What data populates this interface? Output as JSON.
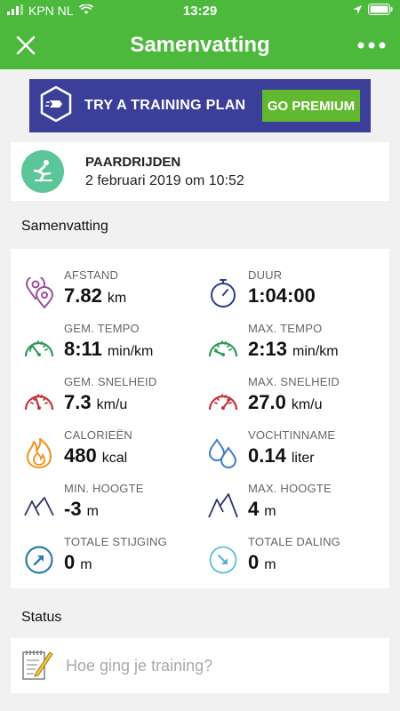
{
  "status_bar": {
    "carrier": "KPN NL",
    "time": "13:29"
  },
  "nav": {
    "title": "Samenvatting"
  },
  "banner": {
    "text": "TRY A TRAINING PLAN",
    "button": "GO PREMIUM"
  },
  "activity": {
    "type": "PAARDRIJDEN",
    "date": "2 februari 2019 om 10:52"
  },
  "sections": {
    "summary": "Samenvatting",
    "status": "Status"
  },
  "stats": [
    {
      "label": "AFSTAND",
      "value": "7.82",
      "unit": "km",
      "icon": "location-pins-icon"
    },
    {
      "label": "DUUR",
      "value": "1:04:00",
      "unit": "",
      "icon": "stopwatch-icon"
    },
    {
      "label": "GEM. TEMPO",
      "value": "8:11",
      "unit": "min/km",
      "icon": "speedometer-icon"
    },
    {
      "label": "MAX. TEMPO",
      "value": "2:13",
      "unit": "min/km",
      "icon": "speedometer-icon"
    },
    {
      "label": "GEM. SNELHEID",
      "value": "7.3",
      "unit": "km/u",
      "icon": "speedometer-icon"
    },
    {
      "label": "MAX. SNELHEID",
      "value": "27.0",
      "unit": "km/u",
      "icon": "speedometer-icon"
    },
    {
      "label": "CALORIEËN",
      "value": "480",
      "unit": "kcal",
      "icon": "flame-icon"
    },
    {
      "label": "VOCHTINNAME",
      "value": "0.14",
      "unit": "liter",
      "icon": "water-drops-icon"
    },
    {
      "label": "MIN. HOOGTE",
      "value": "-3",
      "unit": "m",
      "icon": "mountain-icon"
    },
    {
      "label": "MAX. HOOGTE",
      "value": "4",
      "unit": "m",
      "icon": "mountain-icon"
    },
    {
      "label": "TOTALE STIJGING",
      "value": "0",
      "unit": "m",
      "icon": "ascent-arrow-icon"
    },
    {
      "label": "TOTALE DALING",
      "value": "0",
      "unit": "m",
      "icon": "descent-arrow-icon"
    }
  ],
  "status_input": {
    "placeholder": "Hoe ging je training?"
  },
  "colors": {
    "header_green": "#4cb93d",
    "banner_blue": "#3b3f9a",
    "premium_green": "#62b82f",
    "speed_green": "#2f9a57",
    "speed_red": "#c8323a",
    "location_purple": "#9b4e9a",
    "stopwatch_blue": "#2b3c8a",
    "flame_orange": "#f2911f",
    "water_blue": "#3f7fc4",
    "mountain_navy": "#2d3470",
    "ascent_blue": "#2a7ea8",
    "descent_cyan": "#4fb6d6"
  }
}
